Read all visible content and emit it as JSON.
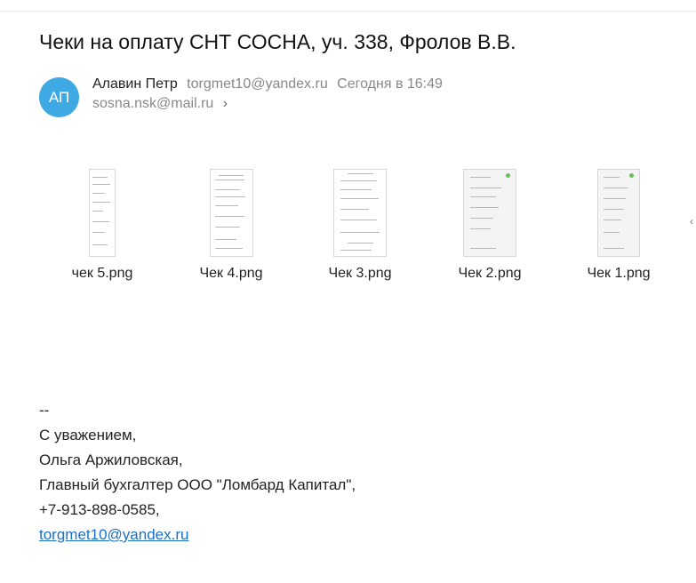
{
  "email": {
    "subject": "Чеки на оплату СНТ СОСНА, уч. 338, Фролов В.В.",
    "avatar_initials": "АП",
    "sender_name": "Алавин Петр",
    "sender_email": "torgmet10@yandex.ru",
    "date": "Сегодня в 16:49",
    "recipient": "sosna.nsk@mail.ru"
  },
  "attachments": [
    {
      "name": "чек 5.png"
    },
    {
      "name": "Чек 4.png"
    },
    {
      "name": "Чек 3.png"
    },
    {
      "name": "Чек 2.png"
    },
    {
      "name": "Чек 1.png"
    }
  ],
  "signature": {
    "separator": "--",
    "line1": "С уважением,",
    "line2": "Ольга Аржиловская,",
    "line3": "Главный бухгалтер ООО \"Ломбард Капитал\",",
    "line4": "+7-913-898-0585,",
    "link": "torgmet10@yandex.ru"
  },
  "icons": {
    "recipient_chevron": "chevron-right-icon",
    "scroll_arrow": "chevron-right-icon"
  },
  "colors": {
    "avatar": "#3fa9e3",
    "link": "#1a6fc9",
    "muted": "#888888"
  }
}
